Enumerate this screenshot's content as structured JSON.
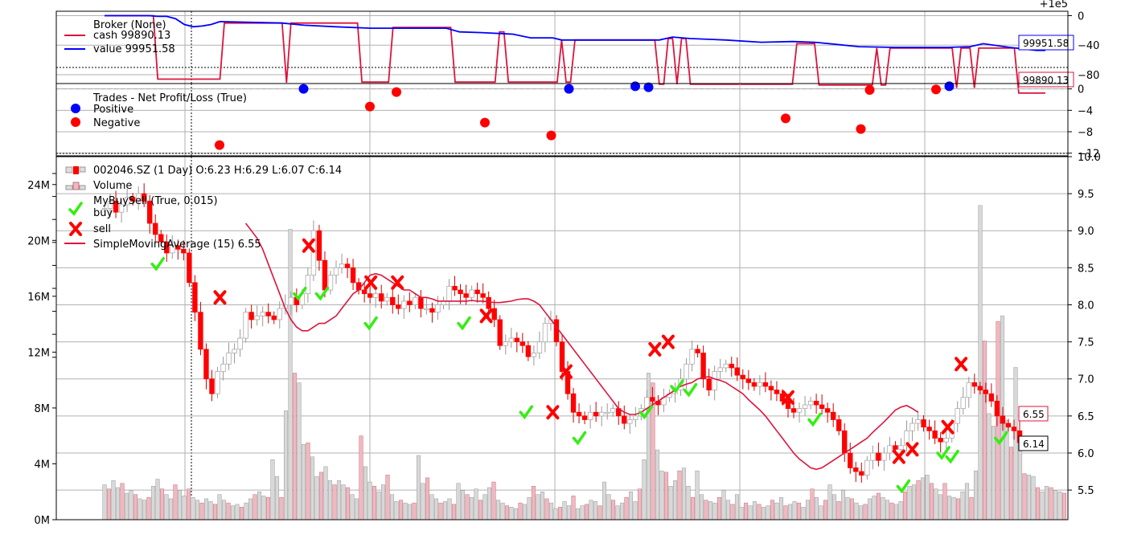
{
  "chart_data": [
    {
      "type": "line",
      "panel": "broker",
      "offset_label": "+1e5",
      "y_ticks": [
        0,
        -40,
        -80
      ],
      "ylim": [
        -92,
        6
      ],
      "grid": true,
      "legend": {
        "position": "top-left",
        "title": "Broker (None)",
        "entries": [
          {
            "label": "cash 99890.13",
            "color": "#dc143c"
          },
          {
            "label": "value 99951.58",
            "color": "#0000ff"
          }
        ]
      },
      "tags": {
        "value": "99951.58",
        "cash": "99890.13"
      },
      "series": [
        {
          "name": "cash",
          "color": "#dc143c",
          "points": [
            [
              0,
              0
            ],
            [
              11,
              0
            ],
            [
              12,
              -86
            ],
            [
              26,
              -86
            ],
            [
              27,
              -10
            ],
            [
              40,
              -10
            ],
            [
              41,
              -91
            ],
            [
              42,
              -10
            ],
            [
              57,
              -10
            ],
            [
              58,
              -90
            ],
            [
              64,
              -90
            ],
            [
              65,
              -16
            ],
            [
              78,
              -16
            ],
            [
              79,
              -90
            ],
            [
              88,
              -90
            ],
            [
              89,
              -22
            ],
            [
              90,
              -22
            ],
            [
              91,
              -90
            ],
            [
              102,
              -90
            ],
            [
              103,
              -33
            ],
            [
              104,
              -90
            ],
            [
              105,
              -90
            ],
            [
              106,
              -33
            ],
            [
              124,
              -33
            ],
            [
              125,
              -93
            ],
            [
              126,
              -93
            ],
            [
              127,
              -31
            ],
            [
              128,
              -31
            ],
            [
              129,
              -93
            ],
            [
              130,
              -31
            ],
            [
              131,
              -31
            ],
            [
              132,
              -93
            ],
            [
              155,
              -93
            ],
            [
              156,
              -38
            ],
            [
              160,
              -38
            ],
            [
              161,
              -94
            ],
            [
              173,
              -94
            ],
            [
              174,
              -44
            ],
            [
              175,
              -94
            ],
            [
              176,
              -94
            ],
            [
              177,
              -44
            ],
            [
              191,
              -44
            ],
            [
              192,
              -98
            ],
            [
              193,
              -44
            ],
            [
              195,
              -44
            ],
            [
              196,
              -98
            ],
            [
              197,
              -44
            ],
            [
              205,
              -44
            ],
            [
              206,
              -105
            ],
            [
              212,
              -105
            ]
          ]
        },
        {
          "name": "value",
          "color": "#0000ff",
          "points": [
            [
              0,
              0
            ],
            [
              10,
              0
            ],
            [
              12,
              -1
            ],
            [
              14,
              -1
            ],
            [
              16,
              -4
            ],
            [
              18,
              -12
            ],
            [
              20,
              -15
            ],
            [
              22,
              -14
            ],
            [
              24,
              -12
            ],
            [
              26,
              -8
            ],
            [
              40,
              -10
            ],
            [
              45,
              -13
            ],
            [
              52,
              -15
            ],
            [
              60,
              -17
            ],
            [
              72,
              -17
            ],
            [
              77,
              -17
            ],
            [
              80,
              -22
            ],
            [
              85,
              -23
            ],
            [
              92,
              -25
            ],
            [
              96,
              -30
            ],
            [
              101,
              -30
            ],
            [
              103,
              -33
            ],
            [
              125,
              -33
            ],
            [
              128,
              -29
            ],
            [
              132,
              -31
            ],
            [
              140,
              -33
            ],
            [
              148,
              -36
            ],
            [
              155,
              -35
            ],
            [
              160,
              -36
            ],
            [
              165,
              -39
            ],
            [
              170,
              -42
            ],
            [
              178,
              -43
            ],
            [
              190,
              -43
            ],
            [
              195,
              -42
            ],
            [
              198,
              -38
            ],
            [
              204,
              -43
            ],
            [
              210,
              -47
            ],
            [
              212,
              -47
            ]
          ]
        }
      ]
    },
    {
      "type": "scatter",
      "panel": "trades",
      "y_ticks": [
        0,
        -4,
        -8,
        -12
      ],
      "ylim": [
        -12.5,
        1
      ],
      "grid": true,
      "legend": {
        "position": "top-left",
        "title": "Trades - Net Profit/Loss (True)",
        "entries": [
          {
            "label": "Positive",
            "color": "#0000ff"
          },
          {
            "label": "Negative",
            "color": "#ff0000"
          }
        ]
      },
      "positive": [
        [
          45,
          0
        ],
        [
          105,
          0
        ],
        [
          120,
          0.5
        ],
        [
          123,
          0.3
        ],
        [
          191,
          0.5
        ]
      ],
      "negative": [
        [
          26,
          -10.5
        ],
        [
          60,
          -3.3
        ],
        [
          66,
          -0.6
        ],
        [
          86,
          -6.3
        ],
        [
          101,
          -8.7
        ],
        [
          154,
          -5.5
        ],
        [
          171,
          -7.5
        ],
        [
          173,
          -0.2
        ],
        [
          188,
          -0.1
        ]
      ]
    },
    {
      "type": "candlestick",
      "panel": "price",
      "legend": {
        "position": "top-left",
        "entries": [
          {
            "label": "002046.SZ (1 Day) O:6.23 H:6.29 L:6.07 C:6.14",
            "color": "#ff0000"
          },
          {
            "label": "Volume",
            "color": "#e8a0a8"
          },
          {
            "label": "MyBuySell (True, 0.015)",
            "color": "#33dd22"
          },
          {
            "label": "buy",
            "color": "#33dd22"
          },
          {
            "label": "sell",
            "color": "#ff0000"
          },
          {
            "label": "SimpleMovingAverage (15) 6.55",
            "color": "#dc143c"
          }
        ]
      },
      "price_ticks": [
        "5.5",
        "6.0",
        "6.5",
        "7.0",
        "7.5",
        "8.0",
        "8.5",
        "9.0",
        "9.5",
        "10.0"
      ],
      "price_lim": [
        5.1,
        10.0
      ],
      "volume_ticks": [
        "0M",
        "4M",
        "8M",
        "12M",
        "16M",
        "20M",
        "24M"
      ],
      "volume_lim": [
        0,
        26
      ],
      "grid": true,
      "tags": {
        "sma": "6.55",
        "close": "6.14"
      },
      "closes": [
        9.3,
        9.4,
        9.25,
        9.35,
        9.45,
        9.4,
        9.5,
        9.4,
        9.1,
        8.95,
        8.85,
        8.7,
        8.8,
        8.75,
        8.7,
        8.3,
        7.9,
        7.4,
        7.0,
        6.8,
        7.1,
        7.2,
        7.35,
        7.4,
        7.55,
        7.9,
        7.8,
        7.85,
        7.9,
        7.85,
        7.8,
        7.95,
        8.0,
        8.1,
        8.0,
        8.15,
        8.4,
        9.0,
        8.6,
        8.2,
        8.4,
        8.5,
        8.55,
        8.5,
        8.3,
        8.2,
        8.15,
        8.1,
        8.15,
        8.05,
        8.1,
        8.0,
        7.95,
        8.05,
        8.0,
        8.1,
        7.95,
        7.95,
        7.9,
        8.0,
        8.05,
        8.25,
        8.2,
        8.15,
        8.1,
        8.2,
        8.15,
        8.1,
        7.95,
        7.8,
        7.45,
        7.5,
        7.55,
        7.5,
        7.45,
        7.3,
        7.35,
        7.5,
        7.75,
        7.8,
        7.5,
        7.1,
        6.8,
        6.55,
        6.5,
        6.45,
        6.55,
        6.5,
        6.55,
        6.55,
        6.6,
        6.5,
        6.4,
        6.45,
        6.5,
        6.6,
        6.75,
        6.7,
        6.65,
        6.75,
        6.8,
        6.85,
        7.0,
        7.2,
        7.4,
        7.35,
        7.0,
        6.85,
        7.1,
        7.15,
        7.2,
        7.15,
        7.05,
        7.0,
        6.95,
        6.9,
        6.95,
        6.9,
        6.85,
        6.8,
        6.7,
        6.6,
        6.55,
        6.6,
        6.65,
        6.7,
        6.65,
        6.6,
        6.55,
        6.45,
        6.3,
        6.0,
        5.8,
        5.75,
        5.7,
        5.9,
        6.0,
        5.9,
        6.0,
        6.1,
        6.05,
        6.1,
        6.3,
        6.4,
        6.45,
        6.35,
        6.3,
        6.2,
        6.15,
        6.2,
        6.4,
        6.6,
        6.75,
        6.95,
        6.9,
        6.85,
        6.8,
        6.7,
        6.5,
        6.4,
        6.35,
        6.3,
        6.14
      ],
      "sma": [
        null,
        null,
        null,
        null,
        null,
        null,
        null,
        null,
        null,
        null,
        null,
        null,
        null,
        null,
        null,
        9.1,
        9.0,
        8.9,
        8.75,
        8.55,
        8.35,
        8.15,
        7.95,
        7.8,
        7.7,
        7.65,
        7.65,
        7.7,
        7.75,
        7.75,
        7.8,
        7.85,
        7.95,
        8.05,
        8.15,
        8.2,
        8.3,
        8.4,
        8.42,
        8.4,
        8.35,
        8.3,
        8.25,
        8.2,
        8.2,
        8.15,
        8.1,
        8.1,
        8.08,
        8.05,
        8.05,
        8.05,
        8.05,
        8.05,
        8.05,
        8.06,
        8.05,
        8.05,
        8.04,
        8.03,
        8.03,
        8.04,
        8.05,
        8.07,
        8.08,
        8.08,
        8.05,
        8.0,
        7.9,
        7.8,
        7.7,
        7.6,
        7.5,
        7.4,
        7.3,
        7.2,
        7.1,
        7.0,
        6.9,
        6.8,
        6.7,
        6.6,
        6.55,
        6.52,
        6.52,
        6.55,
        6.6,
        6.65,
        6.7,
        6.75,
        6.8,
        6.85,
        6.9,
        6.93,
        6.95,
        7.0,
        7.02,
        7.03,
        7.0,
        6.98,
        6.95,
        6.9,
        6.85,
        6.8,
        6.72,
        6.65,
        6.58,
        6.5,
        6.4,
        6.3,
        6.2,
        6.1,
        6.0,
        5.92,
        5.86,
        5.8,
        5.78,
        5.8,
        5.85,
        5.9,
        5.95,
        6.0,
        6.05,
        6.1,
        6.15,
        6.2,
        6.28,
        6.35,
        6.42,
        6.5,
        6.58,
        6.62,
        6.64,
        6.6,
        6.55
      ],
      "sma_start": 10,
      "volumes": [
        2.5,
        2.2,
        2.8,
        2.3,
        2.6,
        1.9,
        2.1,
        1.8,
        1.5,
        1.4,
        1.6,
        2.4,
        2.9,
        2.2,
        1.8,
        1.5,
        2.5,
        2.1,
        1.7,
        2.2,
        1.6,
        1.4,
        1.2,
        1.5,
        1.3,
        1.1,
        1.8,
        1.4,
        1.2,
        1.0,
        1.1,
        0.9,
        1.2,
        1.5,
        1.8,
        2.0,
        1.7,
        1.6,
        4.3,
        3.1,
        1.6,
        7.8,
        20.8,
        10.5,
        9.8,
        5.4,
        5.5,
        4.5,
        3.1,
        3.4,
        3.8,
        2.8,
        2.5,
        2.8,
        2.5,
        2.3,
        1.8,
        1.5,
        6.0,
        3.8,
        2.7,
        2.4,
        2.0,
        2.5,
        3.2,
        1.8,
        1.3,
        1.4,
        1.2,
        1.1,
        1.2,
        4.6,
        2.6,
        3.0,
        1.8,
        1.5,
        1.2,
        1.3,
        1.5,
        1.1,
        2.6,
        2.1,
        1.8,
        1.6,
        2.2,
        1.4,
        1.8,
        2.3,
        2.7,
        1.4,
        1.2,
        1.0,
        0.9,
        0.8,
        1.2,
        1.1,
        1.6,
        2.4,
        1.8,
        2.0,
        1.5,
        1.2,
        0.8,
        0.9,
        1.3,
        1.0,
        1.7,
        0.8,
        1.0,
        1.1,
        1.4,
        1.3,
        1.0,
        2.7,
        1.8,
        1.4,
        1.0,
        1.2,
        1.6,
        2.0,
        1.3,
        2.2,
        4.3,
        10.5,
        9.8,
        5.0,
        3.5,
        3.4,
        2.4,
        2.8,
        3.5,
        3.7,
        2.4,
        1.6,
        3.5,
        1.8,
        1.4,
        1.3,
        1.2,
        1.6,
        2.1,
        1.4,
        1.1,
        1.8,
        0.9,
        1.2,
        1.0,
        1.3,
        1.1,
        0.9,
        1.0,
        1.4,
        1.2,
        1.6,
        1.0,
        1.1,
        1.3,
        1.2,
        0.9,
        1.4,
        2.2,
        1.6,
        1.0,
        1.4,
        2.5,
        1.8,
        1.3,
        2.1,
        1.6,
        1.5,
        1.2,
        1.0,
        1.1,
        1.5,
        1.7,
        1.9,
        1.6,
        1.4,
        1.2,
        1.1,
        1.3,
        2.0,
        2.4,
        2.5,
        2.8,
        3.0,
        3.2,
        2.6,
        2.2,
        1.8,
        2.6,
        1.7,
        1.6,
        1.5,
        2.0,
        2.6,
        1.6,
        3.5,
        22.5,
        12.8,
        7.6,
        6.7,
        14.2,
        14.6,
        7.1,
        5.2,
        10.9,
        6.3,
        3.3,
        3.2,
        3.1,
        2.3,
        2.0,
        2.4,
        2.3,
        2.1,
        2.0,
        1.9
      ],
      "buys": [
        [
          12,
          8.55
        ],
        [
          44,
          8.15
        ],
        [
          49,
          8.15
        ],
        [
          60,
          7.75
        ],
        [
          81,
          7.75
        ],
        [
          95,
          6.55
        ],
        [
          107,
          6.2
        ],
        [
          122,
          6.55
        ],
        [
          129,
          6.9
        ],
        [
          132,
          6.85
        ],
        [
          160,
          6.45
        ],
        [
          180,
          5.55
        ],
        [
          189,
          6.0
        ],
        [
          191,
          5.95
        ],
        [
          202,
          6.2
        ]
      ],
      "sells": [
        [
          26,
          8.1
        ],
        [
          46,
          8.8
        ],
        [
          60,
          8.3
        ],
        [
          66,
          8.3
        ],
        [
          86,
          7.85
        ],
        [
          101,
          6.55
        ],
        [
          104,
          7.1
        ],
        [
          124,
          7.4
        ],
        [
          127,
          7.5
        ],
        [
          154,
          6.75
        ],
        [
          179,
          5.95
        ],
        [
          182,
          6.05
        ],
        [
          190,
          6.35
        ],
        [
          193,
          7.2
        ]
      ]
    }
  ]
}
